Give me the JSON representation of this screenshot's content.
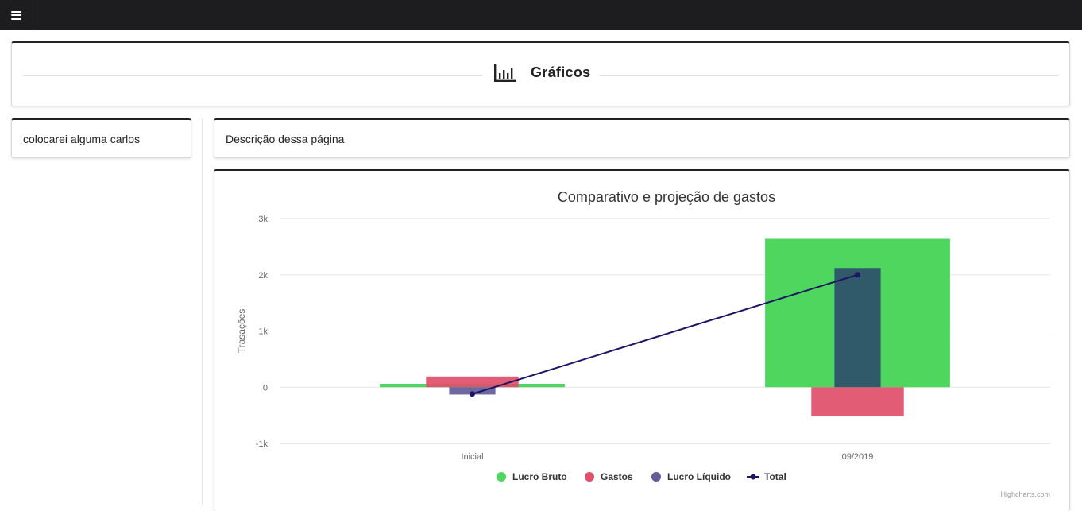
{
  "header": {
    "menu_icon": "hamburger-menu-icon"
  },
  "title_card": {
    "icon": "bar-chart-icon",
    "title": "Gráficos"
  },
  "sidebar": {
    "text": "colocarei alguma carlos"
  },
  "description": {
    "text": "Descrição dessa página"
  },
  "chart_data": {
    "type": "bar",
    "title": "Comparativo e projeção de gastos",
    "xlabel": "",
    "ylabel": "Trasações",
    "categories": [
      "Inicial",
      "09/2019"
    ],
    "ylim": [
      -1000,
      3000
    ],
    "yticks": [
      "-1k",
      "0",
      "1k",
      "2k",
      "3k"
    ],
    "ytick_values": [
      -1000,
      0,
      1000,
      2000,
      3000
    ],
    "grid": true,
    "legend_position": "bottom-center",
    "series": [
      {
        "name": "Lucro Bruto",
        "kind": "bar",
        "color": "#4ed65f",
        "values": [
          60,
          2640
        ]
      },
      {
        "name": "Gastos",
        "kind": "bar",
        "color": "#e0506a",
        "values": [
          190,
          -520
        ]
      },
      {
        "name": "Lucro Líquido",
        "kind": "bar",
        "color": "#625c98",
        "overlap_color": "#2e506b",
        "values": [
          -130,
          2120
        ]
      },
      {
        "name": "Total",
        "kind": "line",
        "color": "#1c1665",
        "values": [
          -120,
          2000
        ]
      }
    ],
    "credits": "Highcharts.com"
  }
}
